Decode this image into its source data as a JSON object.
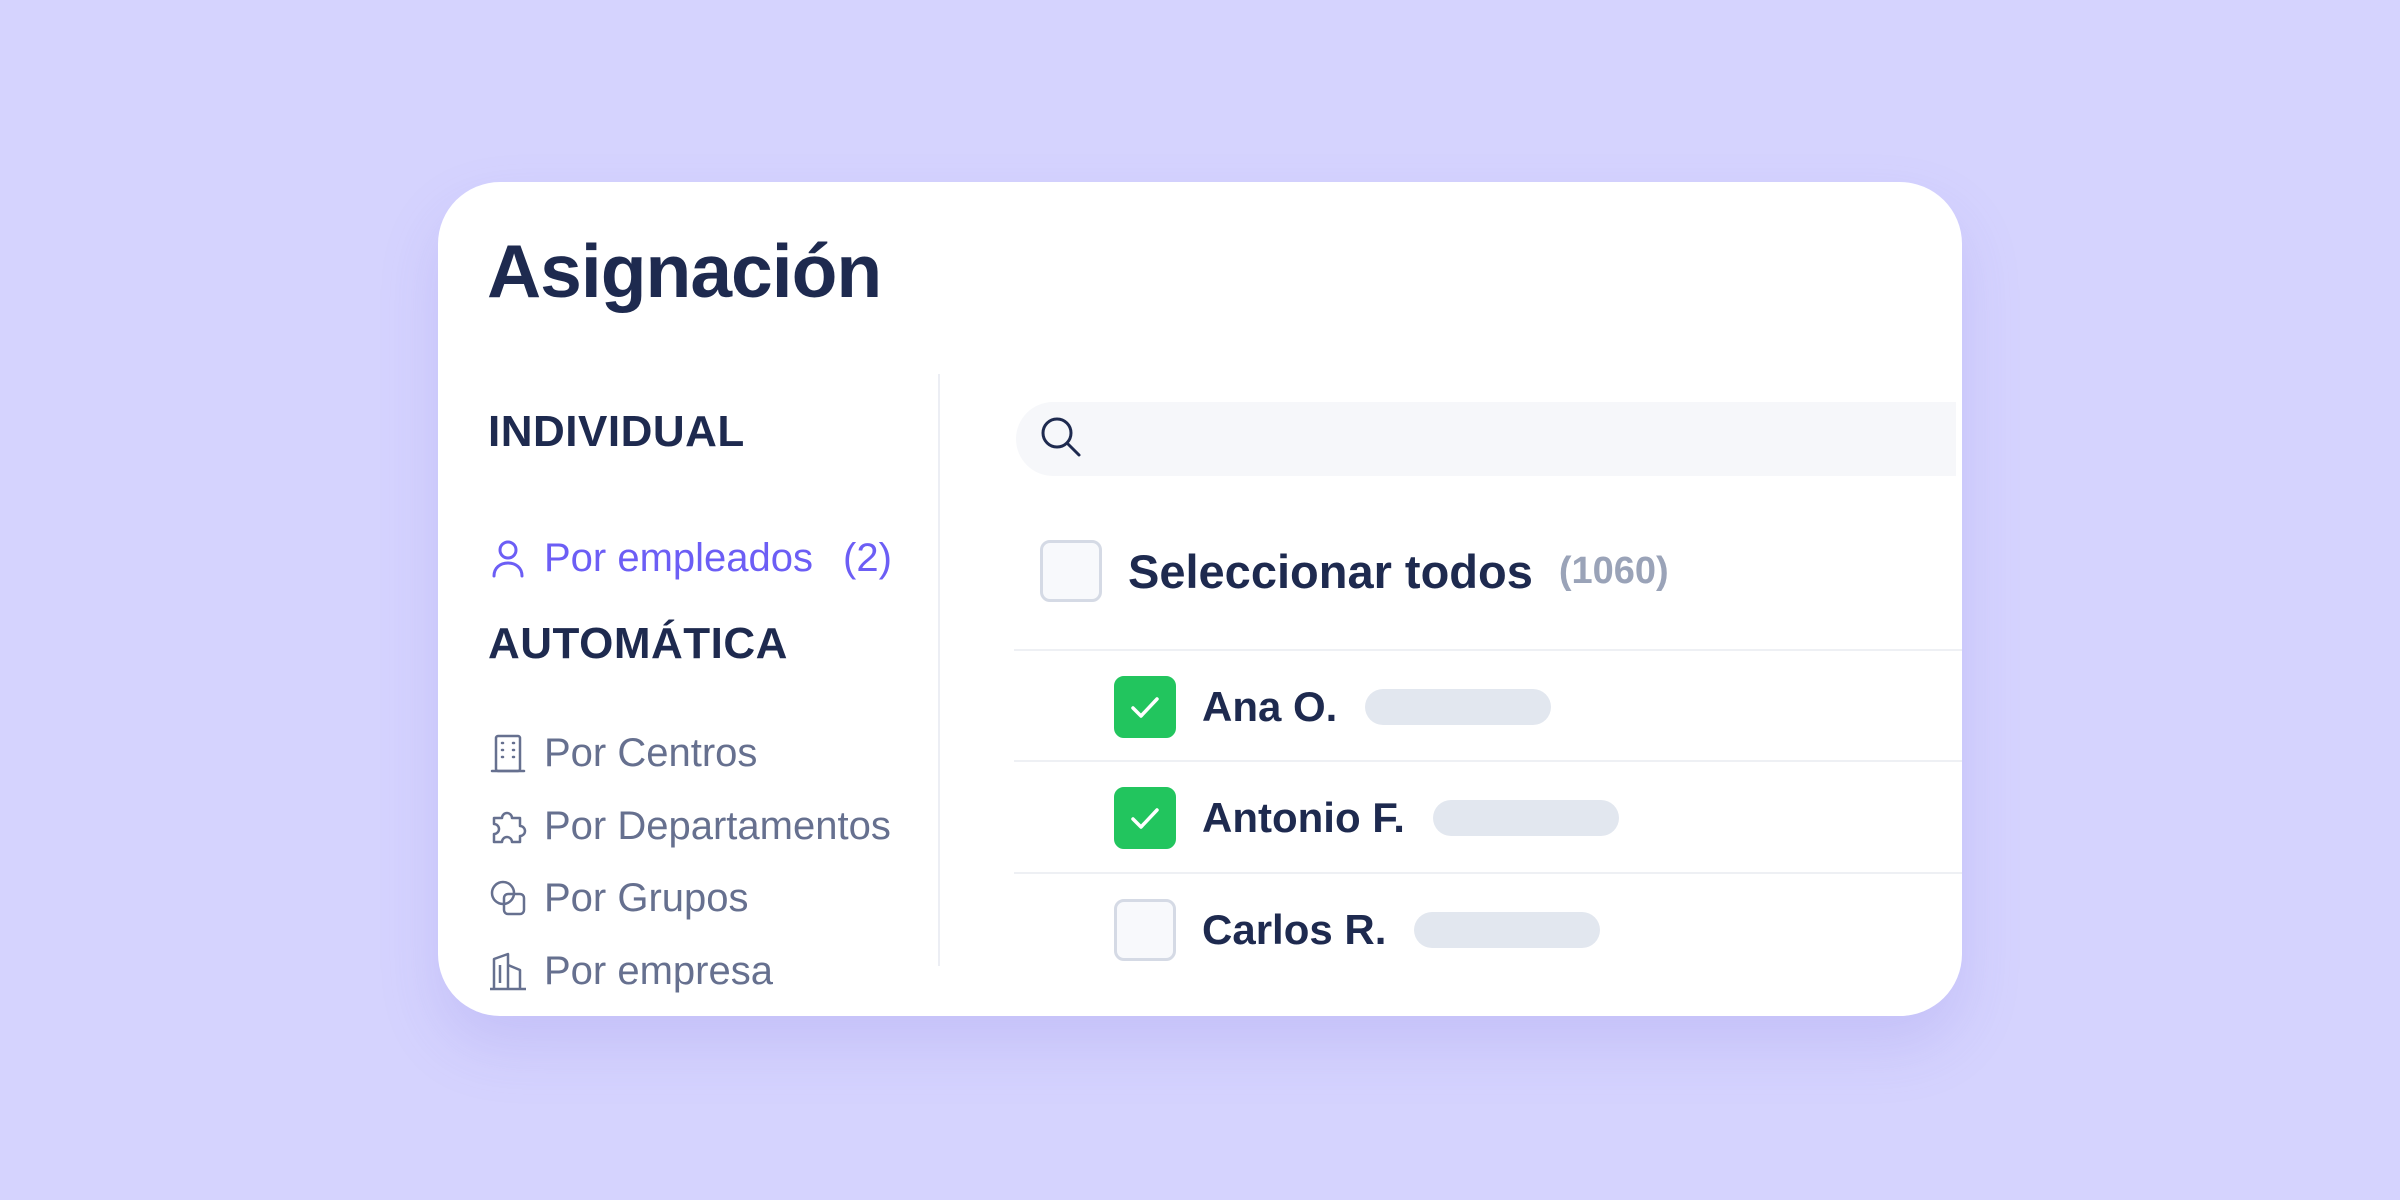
{
  "title": "Asignación",
  "individual": {
    "heading": "INDIVIDUAL",
    "item": {
      "label": "Por empleados",
      "count": "(2)",
      "icon": "user-icon"
    }
  },
  "automatic": {
    "heading": "AUTOMÁTICA",
    "items": [
      {
        "label": "Por Centros",
        "icon": "building-icon"
      },
      {
        "label": "Por Departamentos",
        "icon": "puzzle-icon"
      },
      {
        "label": "Por Grupos",
        "icon": "groups-icon"
      },
      {
        "label": "Por empresa",
        "icon": "company-icon"
      }
    ]
  },
  "search": {
    "placeholder": "",
    "value": ""
  },
  "select_all": {
    "label": "Seleccionar todos",
    "total": "(1060)",
    "checked": false
  },
  "employees": [
    {
      "name": "Ana O.",
      "checked": true
    },
    {
      "name": "Antonio F.",
      "checked": true
    },
    {
      "name": "Carlos R.",
      "checked": false
    }
  ],
  "colors": {
    "background": "#d5d3fe",
    "accent": "#6c5ef5",
    "checked": "#22c55e",
    "heading": "#1e2a4f",
    "muted": "#66708f"
  }
}
